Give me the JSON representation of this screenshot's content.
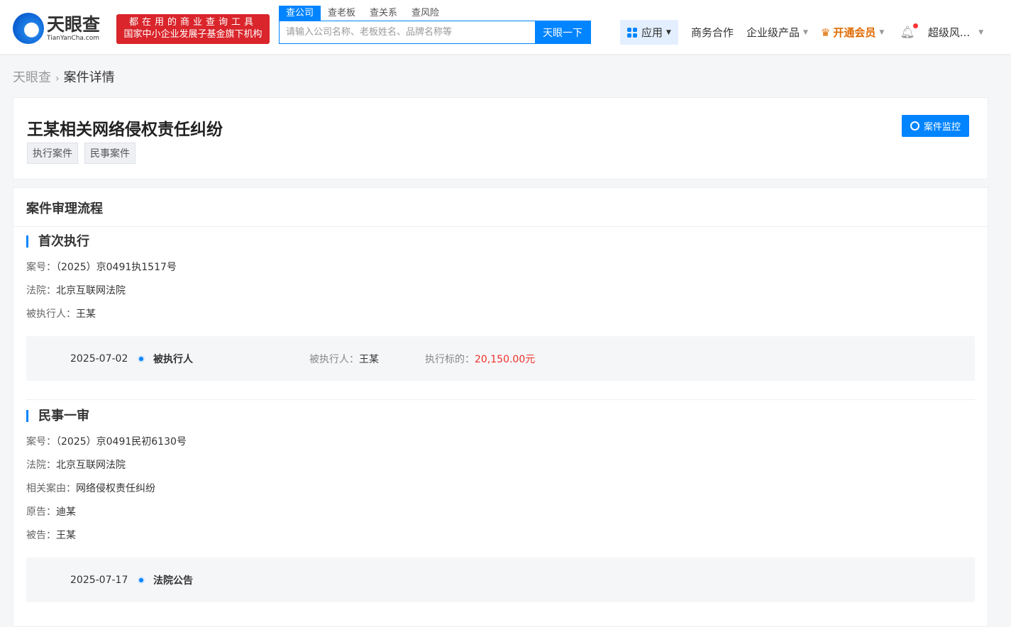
{
  "header": {
    "logo_cn": "天眼查",
    "logo_en": "TianYanCha.com",
    "slogan1": "都在用的商业查询工具",
    "slogan2": "国家中小企业发展子基金旗下机构",
    "search_tabs": [
      "查公司",
      "查老板",
      "查关系",
      "查风险"
    ],
    "search_placeholder": "请输入公司名称、老板姓名、品牌名称等",
    "search_button": "天眼一下",
    "nav": {
      "apps": "应用",
      "business": "商务合作",
      "enterprise": "企业级产品",
      "vip": "开通会员",
      "user": "超级风..."
    }
  },
  "breadcrumb": {
    "home": "天眼查",
    "current": "案件详情"
  },
  "case": {
    "title": "王某相关网络侵权责任纠纷",
    "tags": [
      "执行案件",
      "民事案件"
    ],
    "monitor_button": "案件监控"
  },
  "process": {
    "title": "案件审理流程",
    "sections": [
      {
        "title": "首次执行",
        "fields": [
          {
            "k": "案号：",
            "v": "（2025）京0491执1517号"
          },
          {
            "k": "法院：",
            "v": "北京互联网法院"
          },
          {
            "k": "被执行人：",
            "v": "王某"
          }
        ],
        "event": {
          "date": "2025-07-02",
          "type": "被执行人",
          "k1": "被执行人：",
          "v1": "王某",
          "k2": "执行标的：",
          "v2": "20,150.00元"
        }
      },
      {
        "title": "民事一审",
        "fields": [
          {
            "k": "案号：",
            "v": "（2025）京0491民初6130号"
          },
          {
            "k": "法院：",
            "v": "北京互联网法院"
          },
          {
            "k": "相关案由：",
            "v": "网络侵权责任纠纷"
          },
          {
            "k": "原告：",
            "v": "迪某"
          },
          {
            "k": "被告：",
            "v": "王某"
          }
        ],
        "event": {
          "date": "2025-07-17",
          "type": "法院公告"
        }
      }
    ]
  }
}
